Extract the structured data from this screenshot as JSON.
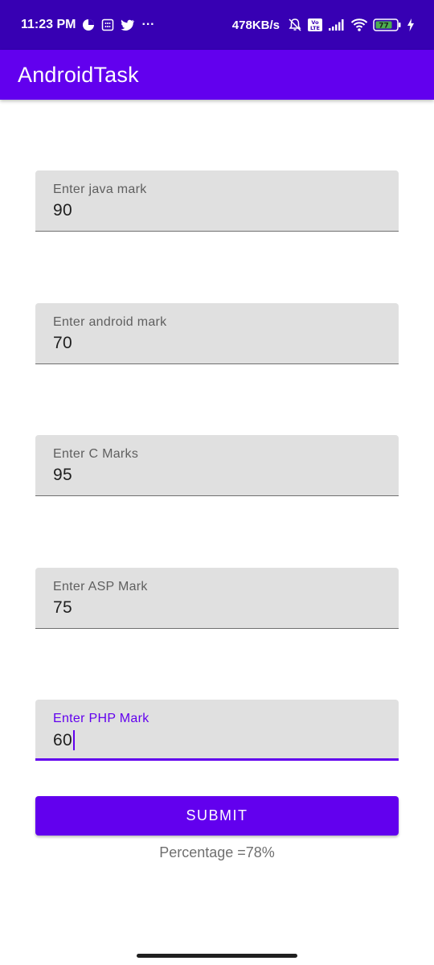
{
  "status_bar": {
    "time": "11:23 PM",
    "more": "···",
    "network_speed": "478KB/s",
    "battery_level": "77",
    "icons": [
      "data-saver-icon",
      "sim-icon",
      "twitter-icon",
      "mute-icon",
      "volte-icon",
      "signal-icon",
      "wifi-icon",
      "battery-icon",
      "charging-icon"
    ]
  },
  "app_bar": {
    "title": "AndroidTask"
  },
  "fields": [
    {
      "label": "Enter java mark",
      "value": "90"
    },
    {
      "label": "Enter android mark",
      "value": "70"
    },
    {
      "label": "Enter C Marks",
      "value": "95"
    },
    {
      "label": "Enter ASP Mark",
      "value": "75"
    },
    {
      "label": "Enter PHP Mark",
      "value": "60"
    }
  ],
  "submit_label": "SUBMIT",
  "result_text": "Percentage =78%",
  "colors": {
    "status_bar": "#3700b3",
    "primary": "#6200ee",
    "field_bg": "#e0e0e0"
  }
}
